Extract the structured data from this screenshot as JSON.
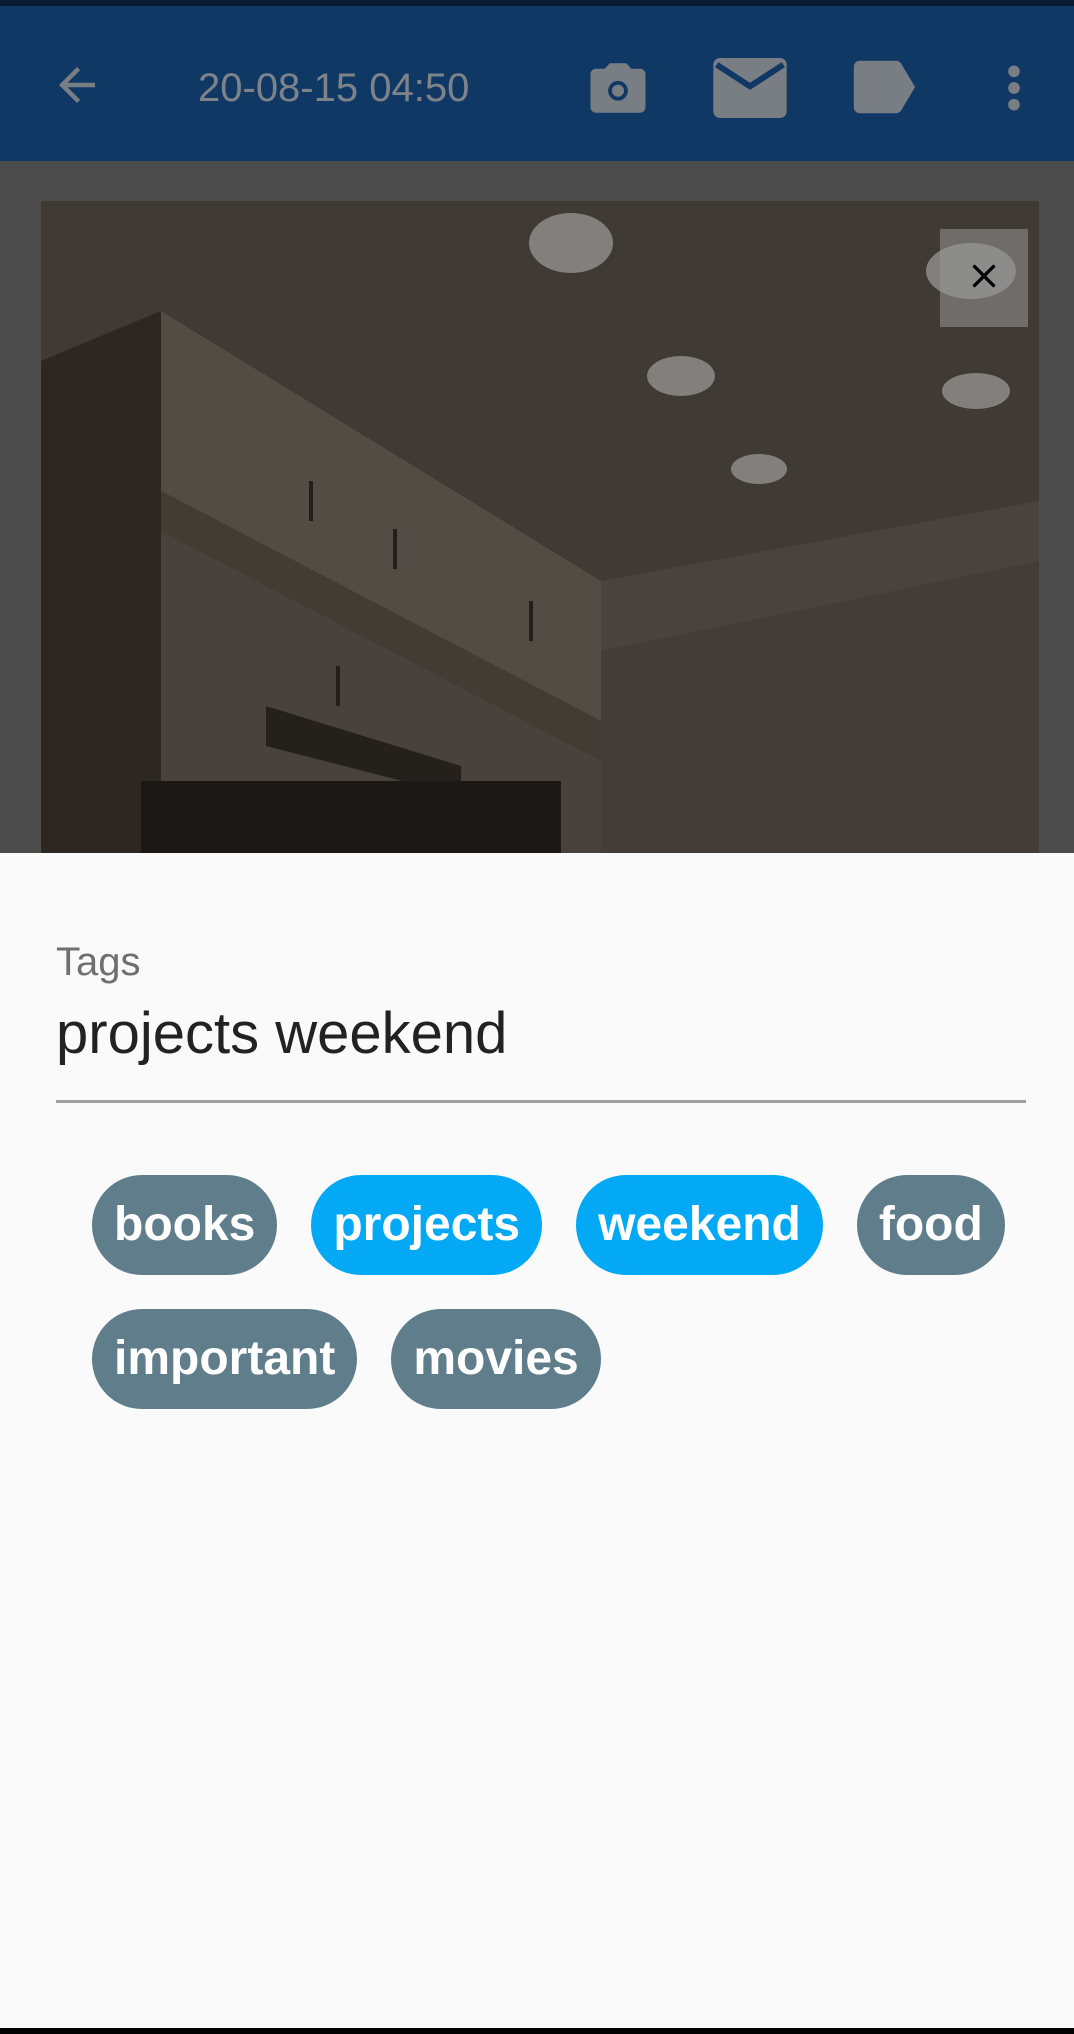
{
  "app_bar": {
    "title": "20-08-15 04:50",
    "icons": [
      "back-arrow-icon",
      "camera-icon",
      "mail-icon",
      "label-icon",
      "more-vert-icon"
    ]
  },
  "image_viewer": {
    "close_icon": "close-icon"
  },
  "tags_sheet": {
    "label": "Tags",
    "input_value": "projects weekend",
    "chips": [
      {
        "label": "books",
        "selected": false
      },
      {
        "label": "projects",
        "selected": true
      },
      {
        "label": "weekend",
        "selected": true
      },
      {
        "label": "food",
        "selected": false
      },
      {
        "label": "important",
        "selected": false
      },
      {
        "label": "movies",
        "selected": false
      }
    ]
  },
  "colors": {
    "app_bar": "#1c5ea7",
    "chip_default": "#607d8b",
    "chip_selected": "#03a9f4",
    "sheet_background": "#fafafa"
  }
}
